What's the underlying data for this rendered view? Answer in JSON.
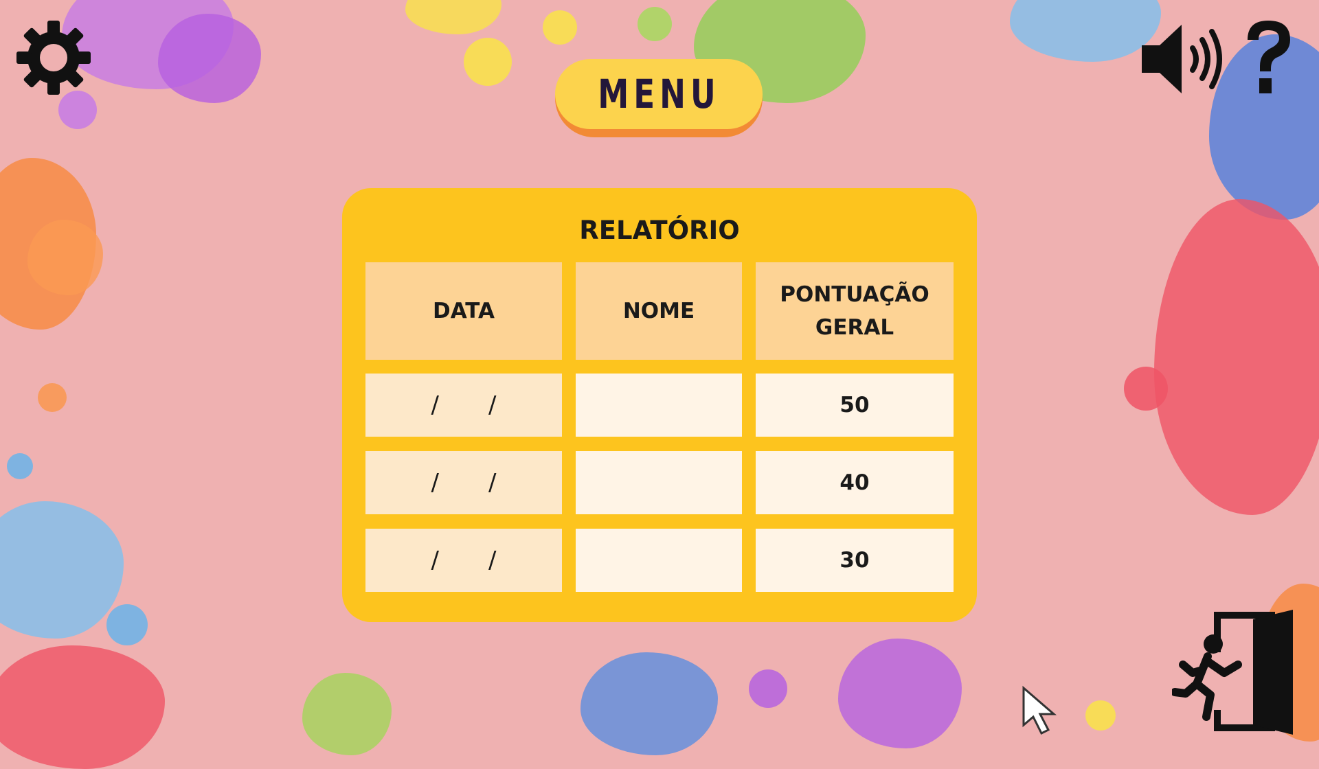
{
  "header": {
    "menu_label": "MENU"
  },
  "report": {
    "title": "RELATÓRIO",
    "columns": [
      "DATA",
      "NOME",
      "PONTUAÇÃO GERAL"
    ],
    "rows": [
      {
        "date_sep_1": "/",
        "date_sep_2": "/",
        "name": "",
        "score": "50"
      },
      {
        "date_sep_1": "/",
        "date_sep_2": "/",
        "name": "",
        "score": "40"
      },
      {
        "date_sep_1": "/",
        "date_sep_2": "/",
        "name": "",
        "score": "30"
      }
    ]
  },
  "icons": {
    "settings": "gear-icon",
    "sound": "speaker-icon",
    "help": "question-mark-icon",
    "exit": "exit-door-icon",
    "pointer": "mouse-pointer-icon"
  },
  "colors": {
    "background": "#efb1b1",
    "panel": "#fdc41e",
    "header_cell": "#fdd395",
    "data_cell": "#fde8c9",
    "menu_button": "#fcd34d",
    "menu_shadow": "#f28a35"
  }
}
